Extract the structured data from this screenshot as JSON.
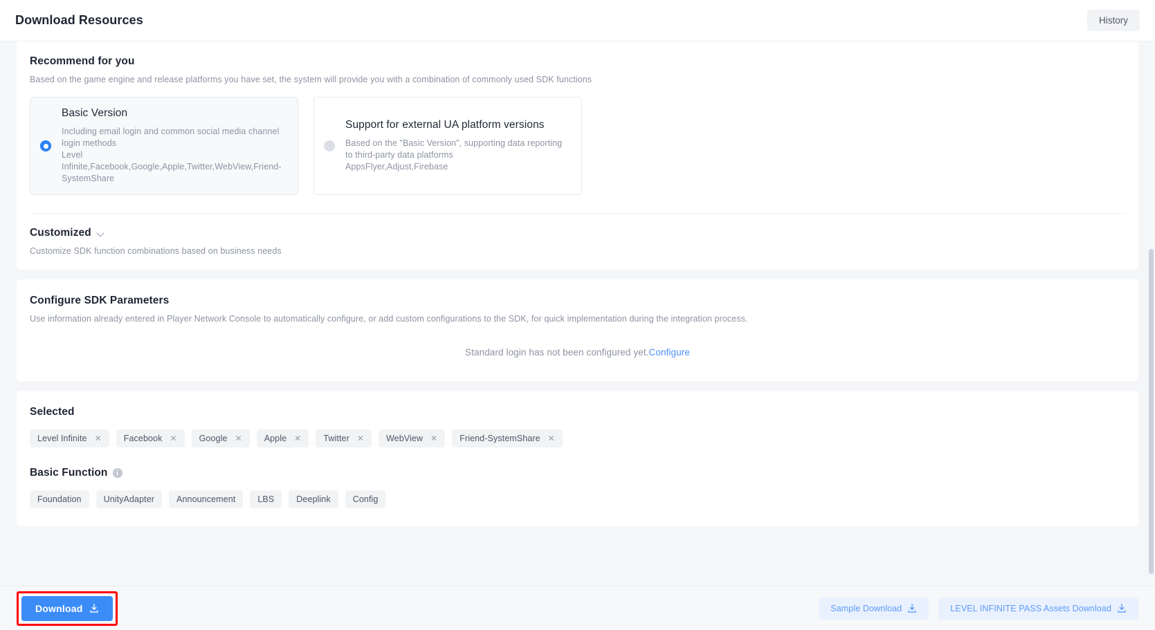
{
  "header": {
    "title": "Download Resources",
    "history_label": "History"
  },
  "recommend": {
    "title": "Recommend for you",
    "desc": "Based on the game engine and release platforms you have set, the system will provide you with a combination of commonly used SDK functions",
    "options": [
      {
        "id": "basic-version",
        "title": "Basic Version",
        "line1": "Including email login and common social media channel login methods",
        "line2": "Level Infinite,Facebook,Google,Apple,Twitter,WebView,Friend-SystemShare",
        "selected": true
      },
      {
        "id": "external-ua",
        "title": "Support for external UA platform versions",
        "line1": "Based on the \"Basic Version\", supporting data reporting to third-party data platforms",
        "line2": "AppsFlyer,Adjust,Firebase",
        "selected": false
      }
    ]
  },
  "customized": {
    "title": "Customized",
    "desc": "Customize SDK function combinations based on business needs",
    "chevron_icon": "chevron-down-icon"
  },
  "configure": {
    "title": "Configure SDK Parameters",
    "desc": "Use information already entered in Player Network Console to automatically configure, or add custom configurations to the SDK, for quick implementation during the integration process.",
    "empty_text": "Standard login has not been configured yet.",
    "link_label": "Configure"
  },
  "selected": {
    "title": "Selected",
    "tags": [
      "Level Infinite",
      "Facebook",
      "Google",
      "Apple",
      "Twitter",
      "WebView",
      "Friend-SystemShare"
    ],
    "remove_icon": "close-icon"
  },
  "basic_function": {
    "title": "Basic Function",
    "info_icon": "info-icon",
    "info_glyph": "i",
    "tags": [
      "Foundation",
      "UnityAdapter",
      "Announcement",
      "LBS",
      "Deeplink",
      "Config"
    ]
  },
  "footer": {
    "download_label": "Download",
    "download_icon": "download-icon",
    "sample_label": "Sample Download",
    "assets_label": "LEVEL INFINITE PASS Assets Download"
  },
  "colors": {
    "accent": "#3c8cf7",
    "link": "#4a90f7",
    "highlight": "#ff0000",
    "tag_bg": "#f2f3f5",
    "ghost_bg": "#eaf1fe"
  }
}
